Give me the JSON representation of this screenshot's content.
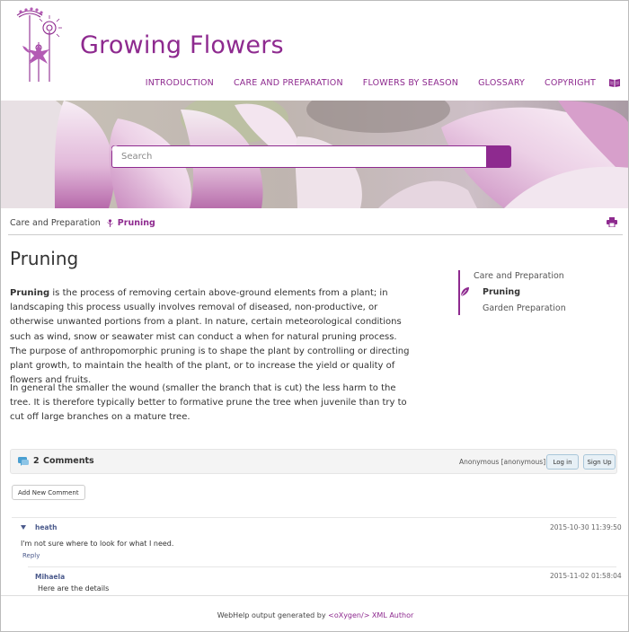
{
  "site": {
    "brand": "Growing Flowers"
  },
  "nav": {
    "items": [
      {
        "label": "INTRODUCTION"
      },
      {
        "label": "CARE AND PREPARATION"
      },
      {
        "label": "FLOWERS BY SEASON"
      },
      {
        "label": "GLOSSARY"
      },
      {
        "label": "COPYRIGHT"
      }
    ],
    "icon": "book-icon"
  },
  "search": {
    "placeholder": "Search",
    "button_icon": "search-icon"
  },
  "breadcrumb": {
    "parent": "Care and Preparation",
    "current": "Pruning"
  },
  "article": {
    "title": "Pruning",
    "para1_term": "Pruning",
    "para1_rest": " is the process of removing certain above-ground elements from a plant; in landscaping this process usually involves removal of diseased, non-productive, or otherwise unwanted portions from a plant. In nature, certain meteorological conditions such as wind, snow or seawater mist can conduct a when for natural pruning process. The purpose of anthropomorphic pruning is to shape the plant by controlling or directing plant growth, to maintain the health of the plant, or to increase the yield or quality of flowers and fruits.",
    "para2": "In general the smaller the wound (smaller the branch that is cut) the less harm to the tree. It is therefore typically better to formative prune the tree when juvenile than try to cut off large branches on a mature tree."
  },
  "toc": {
    "parent": "Care and Preparation",
    "current": "Pruning",
    "child": "Garden Preparation"
  },
  "comments": {
    "count": "2",
    "label": "Comments",
    "user": "Anonymous [anonymous]",
    "login_label": "Log in",
    "signup_label": "Sign Up",
    "add_label": "Add New Comment",
    "items": [
      {
        "author": "heath",
        "date": "2015-10-30 11:39:50",
        "text": "I'm not sure where to look for what I need.",
        "reply": "Reply"
      },
      {
        "author": "Mihaela",
        "date": "2015-11-02 01:58:04",
        "text": "Here are the details"
      }
    ]
  },
  "footer": {
    "prefix": "WebHelp output generated by ",
    "link": "<oXygen/> XML Author"
  },
  "colors": {
    "accent": "#8e2a8f",
    "comment_author": "#4b5a8c"
  }
}
